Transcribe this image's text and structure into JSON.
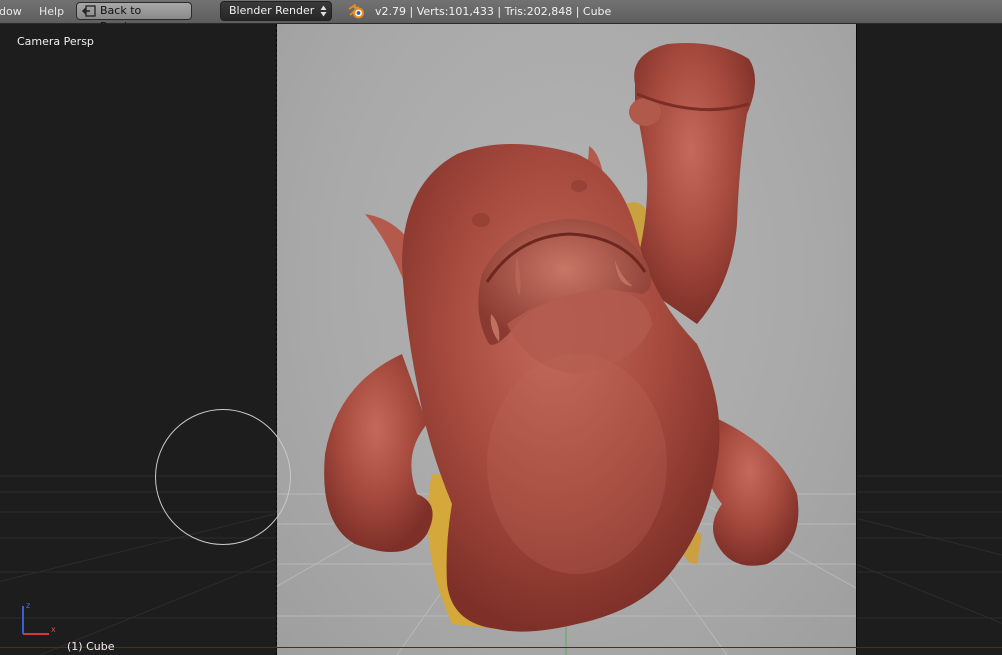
{
  "header": {
    "menu": [
      "dow",
      "Help"
    ],
    "back_button_label": "Back to Previous",
    "render_engine": "Blender Render",
    "stats": "v2.79 | Verts:101,433 | Tris:202,848 | Cube"
  },
  "viewport": {
    "view_name": "Camera Persp",
    "active_object": "(1) Cube",
    "axis_labels": {
      "x": "x",
      "z": "z"
    }
  },
  "icons": {
    "back": "back-arrow-icon",
    "engine_arrows": "updown-arrows-icon",
    "logo": "blender-logo-icon"
  },
  "colors": {
    "header": "#686868",
    "viewport_bg": "#1d1d1d",
    "camera_bg": "#a9a9a9",
    "model": "#a64a3e",
    "model_underside": "#d4a83a"
  }
}
